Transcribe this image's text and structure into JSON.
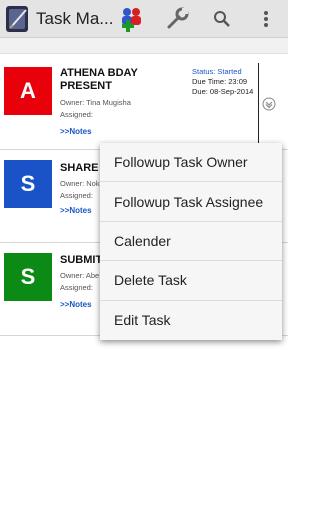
{
  "app": {
    "title": "Task Ma..."
  },
  "tasks": [
    {
      "letter": "A",
      "color": "#e8000b",
      "name": "ATHENA BDAY PRESENT",
      "owner": "Owner: Tina Mugisha",
      "assigned": "Assigned:",
      "notes": ">>Notes",
      "status": "Status: Started",
      "due_time": "Due Time: 23:09",
      "due_date": "Due: 08-Sep-2014"
    },
    {
      "letter": "S",
      "color": "#1a53c8",
      "name": "SHARE",
      "owner": "Owner: Nok",
      "assigned": "Assigned:",
      "notes": ">>Notes"
    },
    {
      "letter": "S",
      "color": "#0b8a15",
      "name": "SUBMIT",
      "owner": "Owner: Abe",
      "assigned": "Assigned:",
      "notes": ">>Notes"
    }
  ],
  "context_menu": {
    "items": [
      "Followup Task Owner",
      "Followup Task Assignee",
      "Calender",
      "Delete Task",
      "Edit Task"
    ]
  }
}
